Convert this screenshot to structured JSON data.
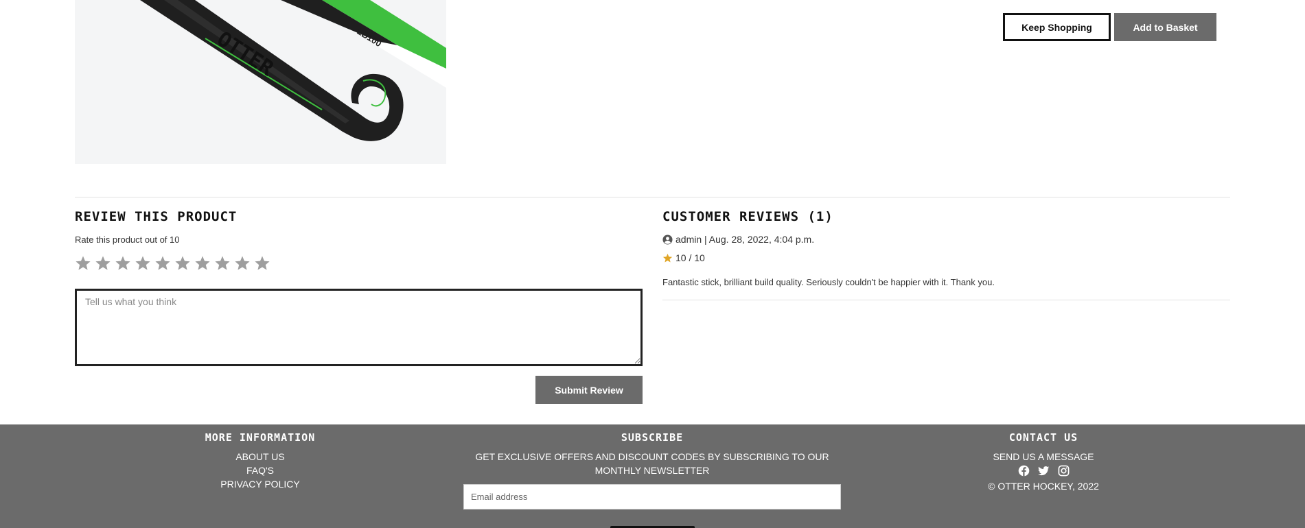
{
  "product": {
    "image_alt": "Otter LB100 hockey stick",
    "stick_brand_text": "OTTER",
    "stick_model_text": "LB100"
  },
  "actions": {
    "keep_shopping_label": "Keep Shopping",
    "add_to_basket_label": "Add to Basket"
  },
  "review_form": {
    "heading": "REVIEW THIS PRODUCT",
    "rate_label": "Rate this product out of 10",
    "star_count": 10,
    "selected_rating": 0,
    "textarea_placeholder": "Tell us what you think",
    "textarea_value": "",
    "submit_label": "Submit Review"
  },
  "customer_reviews": {
    "heading": "CUSTOMER REVIEWS (1)",
    "items": [
      {
        "author": "admin",
        "date": "Aug. 28, 2022, 4:04 p.m.",
        "meta": "admin | Aug. 28, 2022, 4:04 p.m.",
        "rating_text": "10 / 10",
        "body": "Fantastic stick, brilliant build quality. Seriously couldn't be happier with it. Thank you."
      }
    ]
  },
  "footer": {
    "more_info": {
      "heading": "MORE INFORMATION",
      "links": [
        "ABOUT US",
        "FAQ'S",
        "PRIVACY POLICY"
      ]
    },
    "subscribe": {
      "heading": "SUBSCRIBE",
      "text": "GET EXCLUSIVE OFFERS AND DISCOUNT CODES BY SUBSCRIBING TO OUR MONTHLY NEWSLETTER",
      "email_placeholder": "Email address",
      "email_value": ""
    },
    "contact": {
      "heading": "CONTACT US",
      "link": "SEND US A MESSAGE",
      "social_icons": [
        "facebook-icon",
        "twitter-icon",
        "instagram-icon"
      ],
      "copyright": "© OTTER HOCKEY, 2022"
    }
  },
  "colors": {
    "button_gray": "#6b6b6b",
    "footer_bg": "#6b6b6b",
    "star_empty": "#9e9e9e",
    "star_filled": "#e0a526",
    "stick_green": "#3fbf3f",
    "stick_black": "#1f1f1f"
  }
}
